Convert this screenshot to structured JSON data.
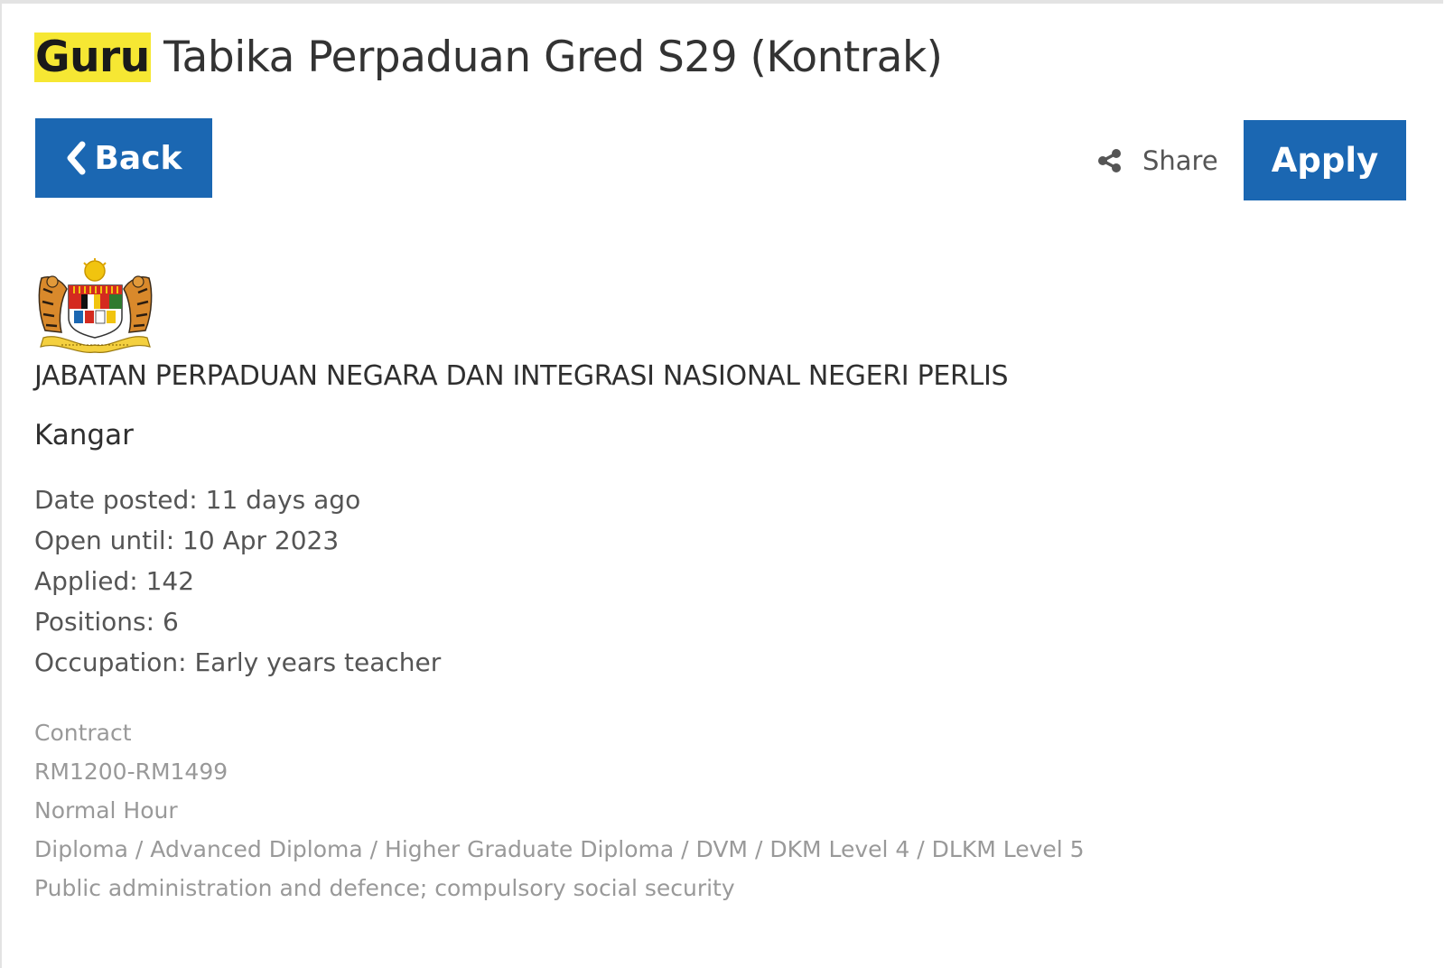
{
  "job": {
    "title_highlight": "Guru",
    "title_rest": " Tabika Perpaduan Gred S29 (Kontrak)"
  },
  "toolbar": {
    "back_label": "Back",
    "share_label": "Share",
    "apply_label": "Apply"
  },
  "employer": {
    "logo_icon": "malaysia-coat-of-arms-icon",
    "name": "JABATAN PERPADUAN NEGARA DAN INTEGRASI NASIONAL NEGERI PERLIS",
    "location": "Kangar"
  },
  "facts": [
    "Date posted: 11 days ago",
    "Open until: 10 Apr 2023",
    "Applied: 142",
    "Positions: 6",
    "Occupation: Early years teacher"
  ],
  "tags": [
    "Contract",
    "RM1200-RM1499",
    "Normal Hour",
    "Diploma / Advanced Diploma / Higher Graduate Diploma / DVM / DKM Level 4 / DLKM Level 5",
    "Public administration and defence; compulsory social security"
  ],
  "colors": {
    "accent": "#1b67b2",
    "highlight": "#f6e733"
  }
}
